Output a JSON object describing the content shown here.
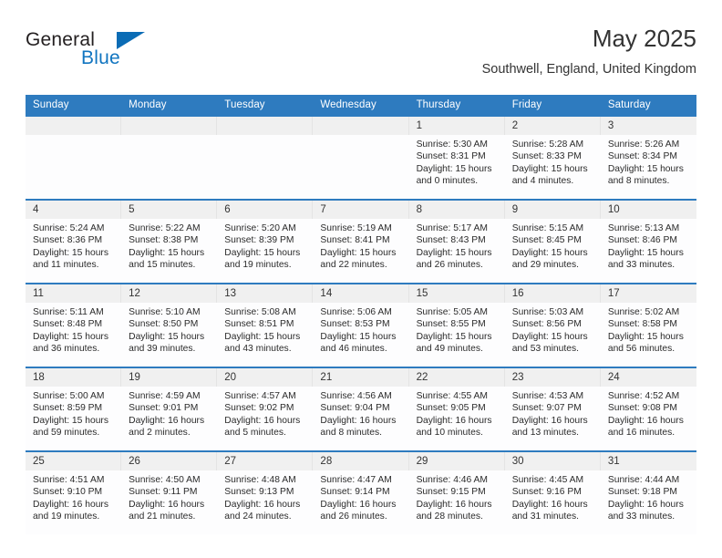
{
  "brand": {
    "word1": "General",
    "word2": "Blue",
    "triangle_color": "#0b6cb5"
  },
  "header": {
    "title": "May 2025",
    "subtitle": "Southwell, England, United Kingdom"
  },
  "theme": {
    "header_blue": "#2e7bbf",
    "daynum_band": "#f0f0f0",
    "cell_bg": "#fdfdfe",
    "text": "#2b2b2b"
  },
  "weekday_headers": [
    "Sunday",
    "Monday",
    "Tuesday",
    "Wednesday",
    "Thursday",
    "Friday",
    "Saturday"
  ],
  "labels": {
    "sunrise_prefix": "Sunrise:",
    "sunset_prefix": "Sunset:",
    "daylight_prefix": "Daylight:"
  },
  "weeks": [
    [
      {
        "day": "",
        "sunrise": "",
        "sunset": "",
        "daylight": "",
        "empty": true
      },
      {
        "day": "",
        "sunrise": "",
        "sunset": "",
        "daylight": "",
        "empty": true
      },
      {
        "day": "",
        "sunrise": "",
        "sunset": "",
        "daylight": "",
        "empty": true
      },
      {
        "day": "",
        "sunrise": "",
        "sunset": "",
        "daylight": "",
        "empty": true
      },
      {
        "day": "1",
        "sunrise": "Sunrise: 5:30 AM",
        "sunset": "Sunset: 8:31 PM",
        "daylight": "Daylight: 15 hours and 0 minutes.",
        "empty": false
      },
      {
        "day": "2",
        "sunrise": "Sunrise: 5:28 AM",
        "sunset": "Sunset: 8:33 PM",
        "daylight": "Daylight: 15 hours and 4 minutes.",
        "empty": false
      },
      {
        "day": "3",
        "sunrise": "Sunrise: 5:26 AM",
        "sunset": "Sunset: 8:34 PM",
        "daylight": "Daylight: 15 hours and 8 minutes.",
        "empty": false
      }
    ],
    [
      {
        "day": "4",
        "sunrise": "Sunrise: 5:24 AM",
        "sunset": "Sunset: 8:36 PM",
        "daylight": "Daylight: 15 hours and 11 minutes.",
        "empty": false
      },
      {
        "day": "5",
        "sunrise": "Sunrise: 5:22 AM",
        "sunset": "Sunset: 8:38 PM",
        "daylight": "Daylight: 15 hours and 15 minutes.",
        "empty": false
      },
      {
        "day": "6",
        "sunrise": "Sunrise: 5:20 AM",
        "sunset": "Sunset: 8:39 PM",
        "daylight": "Daylight: 15 hours and 19 minutes.",
        "empty": false
      },
      {
        "day": "7",
        "sunrise": "Sunrise: 5:19 AM",
        "sunset": "Sunset: 8:41 PM",
        "daylight": "Daylight: 15 hours and 22 minutes.",
        "empty": false
      },
      {
        "day": "8",
        "sunrise": "Sunrise: 5:17 AM",
        "sunset": "Sunset: 8:43 PM",
        "daylight": "Daylight: 15 hours and 26 minutes.",
        "empty": false
      },
      {
        "day": "9",
        "sunrise": "Sunrise: 5:15 AM",
        "sunset": "Sunset: 8:45 PM",
        "daylight": "Daylight: 15 hours and 29 minutes.",
        "empty": false
      },
      {
        "day": "10",
        "sunrise": "Sunrise: 5:13 AM",
        "sunset": "Sunset: 8:46 PM",
        "daylight": "Daylight: 15 hours and 33 minutes.",
        "empty": false
      }
    ],
    [
      {
        "day": "11",
        "sunrise": "Sunrise: 5:11 AM",
        "sunset": "Sunset: 8:48 PM",
        "daylight": "Daylight: 15 hours and 36 minutes.",
        "empty": false
      },
      {
        "day": "12",
        "sunrise": "Sunrise: 5:10 AM",
        "sunset": "Sunset: 8:50 PM",
        "daylight": "Daylight: 15 hours and 39 minutes.",
        "empty": false
      },
      {
        "day": "13",
        "sunrise": "Sunrise: 5:08 AM",
        "sunset": "Sunset: 8:51 PM",
        "daylight": "Daylight: 15 hours and 43 minutes.",
        "empty": false
      },
      {
        "day": "14",
        "sunrise": "Sunrise: 5:06 AM",
        "sunset": "Sunset: 8:53 PM",
        "daylight": "Daylight: 15 hours and 46 minutes.",
        "empty": false
      },
      {
        "day": "15",
        "sunrise": "Sunrise: 5:05 AM",
        "sunset": "Sunset: 8:55 PM",
        "daylight": "Daylight: 15 hours and 49 minutes.",
        "empty": false
      },
      {
        "day": "16",
        "sunrise": "Sunrise: 5:03 AM",
        "sunset": "Sunset: 8:56 PM",
        "daylight": "Daylight: 15 hours and 53 minutes.",
        "empty": false
      },
      {
        "day": "17",
        "sunrise": "Sunrise: 5:02 AM",
        "sunset": "Sunset: 8:58 PM",
        "daylight": "Daylight: 15 hours and 56 minutes.",
        "empty": false
      }
    ],
    [
      {
        "day": "18",
        "sunrise": "Sunrise: 5:00 AM",
        "sunset": "Sunset: 8:59 PM",
        "daylight": "Daylight: 15 hours and 59 minutes.",
        "empty": false
      },
      {
        "day": "19",
        "sunrise": "Sunrise: 4:59 AM",
        "sunset": "Sunset: 9:01 PM",
        "daylight": "Daylight: 16 hours and 2 minutes.",
        "empty": false
      },
      {
        "day": "20",
        "sunrise": "Sunrise: 4:57 AM",
        "sunset": "Sunset: 9:02 PM",
        "daylight": "Daylight: 16 hours and 5 minutes.",
        "empty": false
      },
      {
        "day": "21",
        "sunrise": "Sunrise: 4:56 AM",
        "sunset": "Sunset: 9:04 PM",
        "daylight": "Daylight: 16 hours and 8 minutes.",
        "empty": false
      },
      {
        "day": "22",
        "sunrise": "Sunrise: 4:55 AM",
        "sunset": "Sunset: 9:05 PM",
        "daylight": "Daylight: 16 hours and 10 minutes.",
        "empty": false
      },
      {
        "day": "23",
        "sunrise": "Sunrise: 4:53 AM",
        "sunset": "Sunset: 9:07 PM",
        "daylight": "Daylight: 16 hours and 13 minutes.",
        "empty": false
      },
      {
        "day": "24",
        "sunrise": "Sunrise: 4:52 AM",
        "sunset": "Sunset: 9:08 PM",
        "daylight": "Daylight: 16 hours and 16 minutes.",
        "empty": false
      }
    ],
    [
      {
        "day": "25",
        "sunrise": "Sunrise: 4:51 AM",
        "sunset": "Sunset: 9:10 PM",
        "daylight": "Daylight: 16 hours and 19 minutes.",
        "empty": false
      },
      {
        "day": "26",
        "sunrise": "Sunrise: 4:50 AM",
        "sunset": "Sunset: 9:11 PM",
        "daylight": "Daylight: 16 hours and 21 minutes.",
        "empty": false
      },
      {
        "day": "27",
        "sunrise": "Sunrise: 4:48 AM",
        "sunset": "Sunset: 9:13 PM",
        "daylight": "Daylight: 16 hours and 24 minutes.",
        "empty": false
      },
      {
        "day": "28",
        "sunrise": "Sunrise: 4:47 AM",
        "sunset": "Sunset: 9:14 PM",
        "daylight": "Daylight: 16 hours and 26 minutes.",
        "empty": false
      },
      {
        "day": "29",
        "sunrise": "Sunrise: 4:46 AM",
        "sunset": "Sunset: 9:15 PM",
        "daylight": "Daylight: 16 hours and 28 minutes.",
        "empty": false
      },
      {
        "day": "30",
        "sunrise": "Sunrise: 4:45 AM",
        "sunset": "Sunset: 9:16 PM",
        "daylight": "Daylight: 16 hours and 31 minutes.",
        "empty": false
      },
      {
        "day": "31",
        "sunrise": "Sunrise: 4:44 AM",
        "sunset": "Sunset: 9:18 PM",
        "daylight": "Daylight: 16 hours and 33 minutes.",
        "empty": false
      }
    ]
  ]
}
